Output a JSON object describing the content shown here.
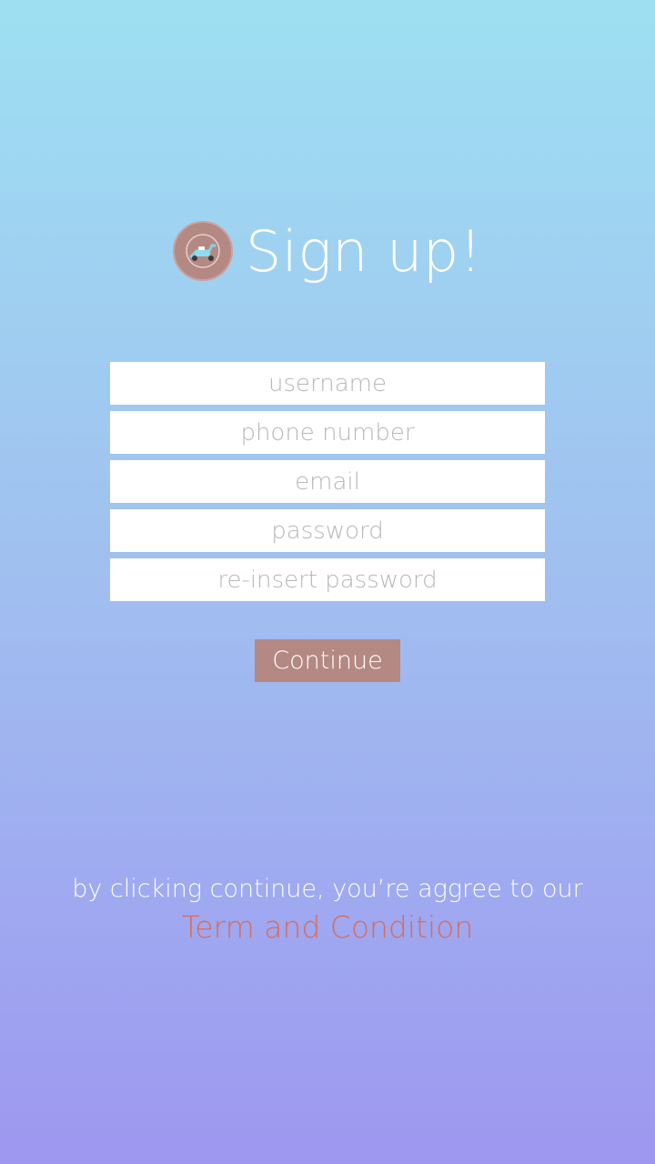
{
  "header": {
    "title": "Sign up!",
    "logo_icon": "scooter-icon"
  },
  "form": {
    "username_placeholder": "username",
    "phone_placeholder": "phone number",
    "email_placeholder": "email",
    "password_placeholder": "password",
    "repassword_placeholder": "re-insert password",
    "username_value": "",
    "phone_value": "",
    "email_value": "",
    "password_value": "",
    "repassword_value": ""
  },
  "actions": {
    "continue_label": "Continue"
  },
  "terms": {
    "text": "by clicking continue, you’re aggree to our",
    "link_label": "Term and Condition"
  },
  "colors": {
    "gradient_top": "#9ee0f2",
    "gradient_bottom": "#9e97f0",
    "accent": "#b48883",
    "link": "#d96b5b"
  }
}
